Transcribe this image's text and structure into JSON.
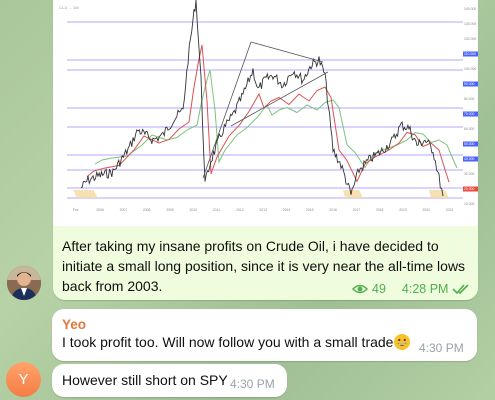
{
  "own_message": {
    "text": "After taking my insane profits on Crude Oil, i have decided to initiate a small long position, since it is very near the all-time lows back from 2003.",
    "views": "49",
    "time": "4:28 PM",
    "status_icon": "double-check-icon",
    "chart_image": {
      "title_text": "CL1! ... 1M",
      "x_ticks": [
        "Fez",
        "2006",
        "2007",
        "2008",
        "2009",
        "2010",
        "2011",
        "2012",
        "2013",
        "2014",
        "2015",
        "2016",
        "2017",
        "2018",
        "2019",
        "2020",
        "2021"
      ],
      "price_tags": [
        "140.000",
        "130.000",
        "120.000",
        "110.000",
        "100.000",
        "90.000",
        "80.000",
        "70.000",
        "60.000",
        "50.000",
        "40.000",
        "30.000",
        "20.000",
        "10.000"
      ],
      "colors": {
        "price": "#3a3a3a",
        "ma_red": "#d9534f",
        "ma_green": "#7cc47c",
        "levels": "#7b61ff",
        "zone": "#f4d9a0"
      }
    }
  },
  "messages": [
    {
      "sender": "Yeo",
      "text": "I took profit too. Will now follow you with a small trade",
      "emoji": "grinning-face-icon",
      "time": "4:30 PM"
    },
    {
      "text": "However still short on SPY",
      "time": "4:30 PM"
    }
  ],
  "avatars": {
    "yeo_initial": "Y"
  },
  "colors": {
    "own_bubble": "#effdde",
    "meta_green": "#4fae4e",
    "sender_orange": "#e07a3a"
  }
}
